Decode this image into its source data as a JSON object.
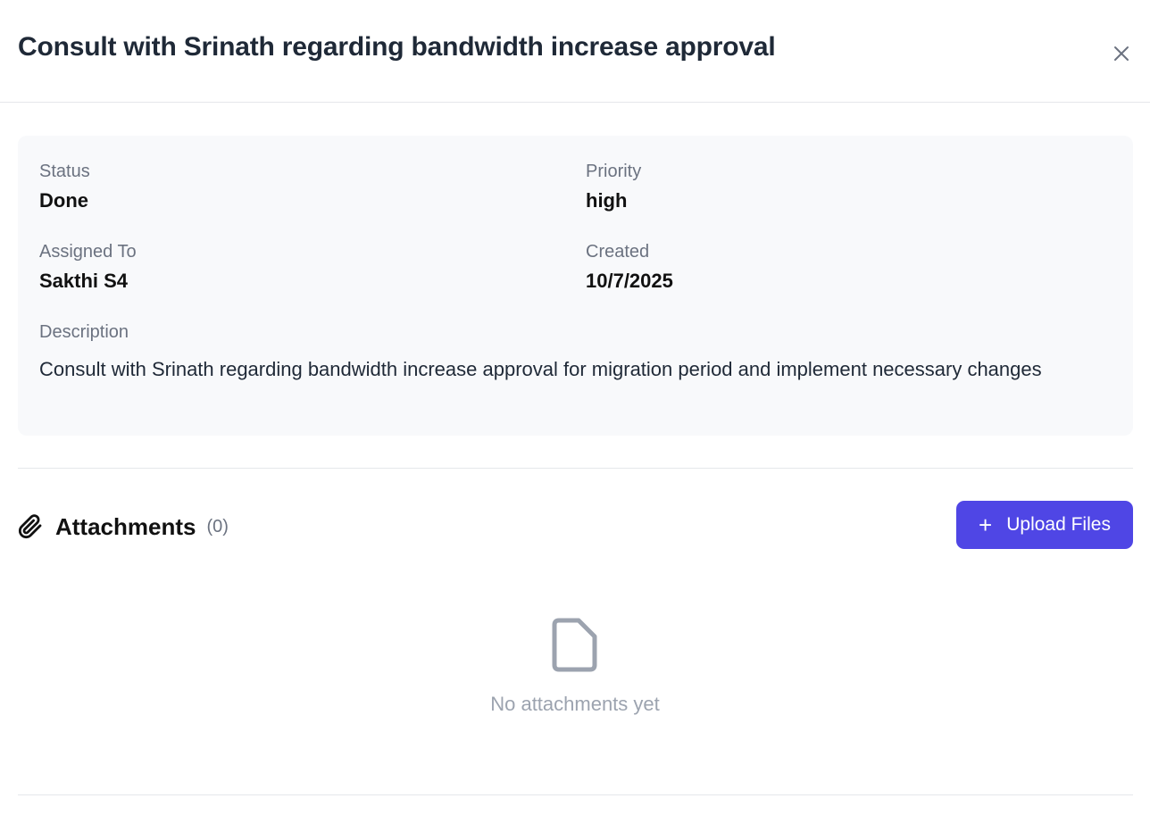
{
  "dialog": {
    "title": "Consult with Srinath regarding bandwidth increase approval",
    "close_icon": "close-icon"
  },
  "details": {
    "status": {
      "label": "Status",
      "value": "Done"
    },
    "priority": {
      "label": "Priority",
      "value": "high"
    },
    "assigned_to": {
      "label": "Assigned To",
      "value": "Sakthi S4"
    },
    "created": {
      "label": "Created",
      "value": "10/7/2025"
    },
    "description": {
      "label": "Description",
      "value": "Consult with Srinath regarding bandwidth increase approval for migration period and implement necessary changes"
    }
  },
  "attachments": {
    "icon": "paperclip-icon",
    "title": "Attachments",
    "count": "(0)",
    "upload_icon": "plus-icon",
    "upload_label": "Upload Files",
    "empty_icon": "file-icon",
    "empty_text": "No attachments yet"
  },
  "colors": {
    "accent": "#4f46e5",
    "card_bg": "#f8f9fb",
    "muted_text": "#6b7280",
    "border": "#e5e7eb"
  }
}
